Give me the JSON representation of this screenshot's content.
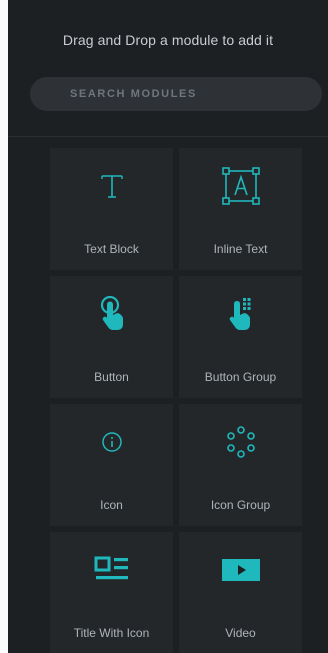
{
  "panel": {
    "hint": "Drag and Drop a module to add it",
    "search": {
      "placeholder": "SEARCH MODULES",
      "value": ""
    }
  },
  "modules": [
    {
      "label": "Text Block",
      "icon": "text-t-icon"
    },
    {
      "label": "Inline Text",
      "icon": "inline-text-icon"
    },
    {
      "label": "Button",
      "icon": "pointer-hand-icon"
    },
    {
      "label": "Button Group",
      "icon": "hand-grid-icon"
    },
    {
      "label": "Icon",
      "icon": "info-circle-icon"
    },
    {
      "label": "Icon Group",
      "icon": "dots-ring-icon"
    },
    {
      "label": "Title With Icon",
      "icon": "title-with-icon-icon"
    },
    {
      "label": "Video",
      "icon": "video-play-icon"
    }
  ],
  "colors": {
    "accent": "#1fb8bc",
    "panel_bg": "#1d2023",
    "tile_bg": "#23272a",
    "label_text": "#aeb4b9"
  }
}
